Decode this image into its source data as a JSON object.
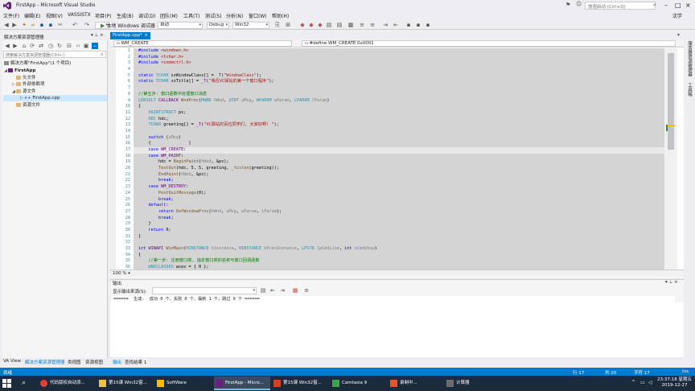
{
  "window": {
    "title": "FirstApp - Microsoft Visual Studio",
    "quick_launch_placeholder": "快速启动 (Ctrl+Q)",
    "user": "沈学"
  },
  "menu": [
    "文件(F)",
    "编辑(E)",
    "视图(V)",
    "VASSISTX",
    "项目(P)",
    "生成(B)",
    "调试(D)",
    "团队(M)",
    "工具(T)",
    "测试(S)",
    "分析(N)",
    "窗口(W)",
    "帮助(H)"
  ],
  "toolbar": {
    "config": "Debug",
    "platform": "Win32",
    "run_label": "本地 Windows 调试器",
    "run_mode": "自动"
  },
  "solution_explorer": {
    "header": "解决方案资源管理器",
    "search_placeholder": "搜索解决方案资源管理器(Ctrl+;)",
    "solution": "解决方案\"FirstApp\"(1 个项目)",
    "project": "FirstApp",
    "items": [
      "头文件",
      "外部依赖项",
      "源文件",
      "FirstApp.cpp",
      "资源文件"
    ]
  },
  "editor": {
    "tab": "FirstApp.cpp*",
    "nav_left": "WM_CREATE",
    "nav_right": "#define WM_CREATE 0x0001",
    "zoom": "100 %",
    "line_numbers": [
      "1",
      "2",
      "3",
      "4",
      "5",
      "6",
      "7",
      "8",
      "9",
      "10",
      "11",
      "12",
      "13",
      "14",
      "15",
      "16",
      "17",
      "18",
      "19",
      "20",
      "21",
      "22",
      "23",
      "24",
      "25",
      "26",
      "27",
      "28",
      "29",
      "30",
      "31",
      "32",
      "33",
      "34",
      "35",
      "36"
    ]
  },
  "output": {
    "header": "输出",
    "source_label": "显示输出来源(S):",
    "text": "======  生成:  成功 0 个，失败 0 个，最新 1 个，跳过 0 个 ======"
  },
  "bottom_tabs": {
    "left": [
      "VA View",
      "解决方案资源管理器",
      "类视图",
      "资源视图"
    ],
    "right": [
      "输出",
      "查找结果 1"
    ]
  },
  "status": {
    "ready": "就绪",
    "line": "行 17",
    "col": "列 20",
    "char": "字符 17",
    "ins": "Ins"
  },
  "right_side_tabs": [
    "服务器资源管理器",
    "工具箱"
  ],
  "taskbar": {
    "items": [
      "代码版权自动添...",
      "第15课 Win32窗...",
      "SoftWare",
      "FirstApp - Micro...",
      "第15课 Win32窗...",
      "Camtasia 9",
      "录制中...",
      "计算器"
    ],
    "time": "23:37:18 星期五",
    "date": "2019-12-27"
  }
}
